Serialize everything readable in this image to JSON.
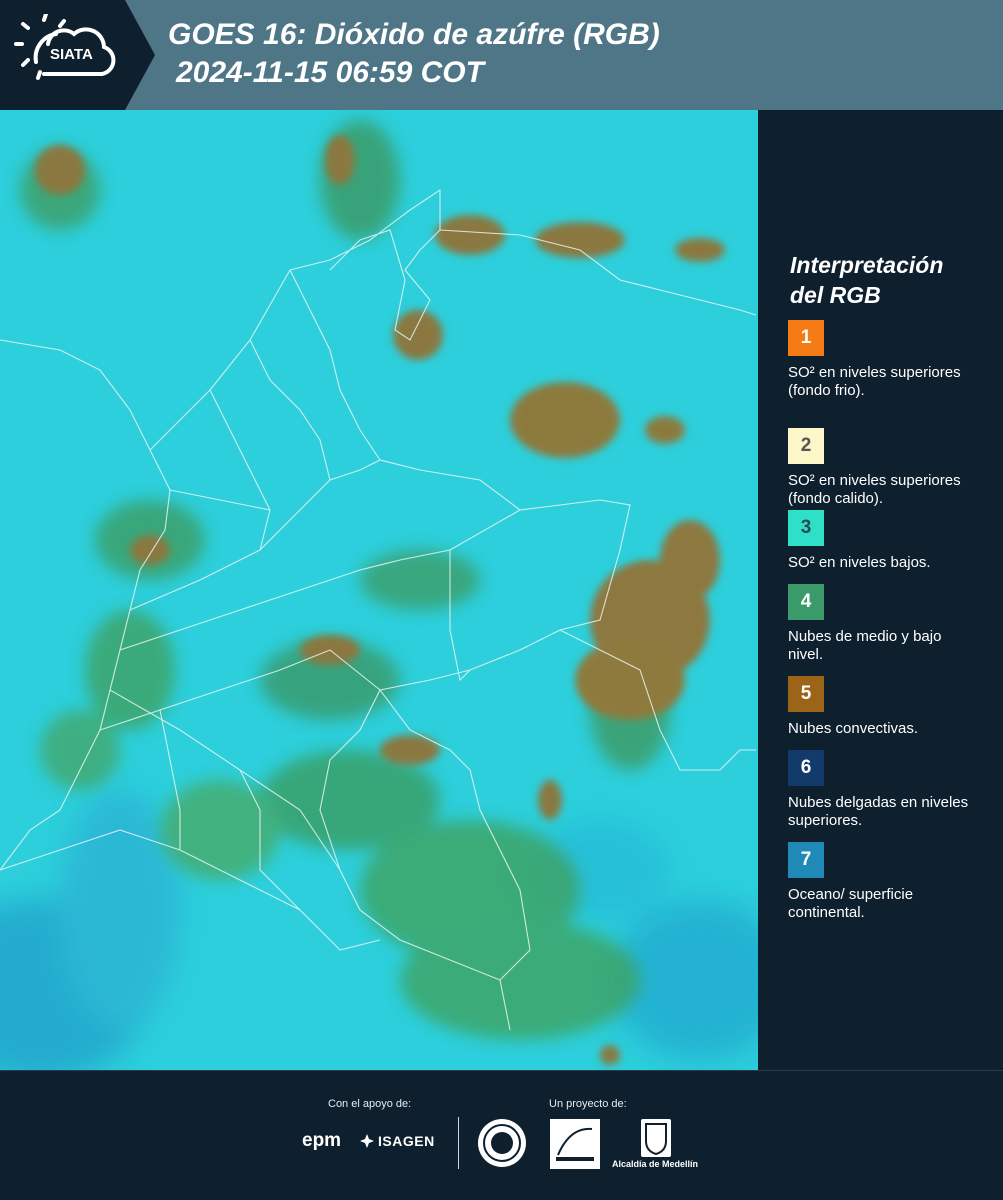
{
  "header": {
    "logo_text": "SIATA",
    "title_line1": "GOES 16: Dióxido de azúfre (RGB)",
    "title_line2": "2024-11-15 06:59 COT"
  },
  "legend": {
    "title_line1": "Interpretación",
    "title_line2": "del RGB",
    "items": [
      {
        "num": "1",
        "color": "#f47b16",
        "num_color": "#ffffff",
        "text": "SO² en niveles superiores (fondo frio)."
      },
      {
        "num": "2",
        "color": "#fdf6c8",
        "num_color": "#555555",
        "text": "SO² en niveles superiores (fondo calido)."
      },
      {
        "num": "3",
        "color": "#2fe0c8",
        "num_color": "#2b4a55",
        "text": "SO² en niveles bajos."
      },
      {
        "num": "4",
        "color": "#3a9a6a",
        "num_color": "#ffffff",
        "text": "Nubes de medio y bajo nivel."
      },
      {
        "num": "5",
        "color": "#9c6418",
        "num_color": "#ffffff",
        "text": "Nubes convectivas."
      },
      {
        "num": "6",
        "color": "#123a6a",
        "num_color": "#ffffff",
        "text": "Nubes delgadas en niveles superiores."
      },
      {
        "num": "7",
        "color": "#1f8ab8",
        "num_color": "#ffffff",
        "text": "Oceano/ superficie continental."
      }
    ]
  },
  "footer": {
    "support_label": "Con el apoyo de:",
    "project_label": "Un proyecto de:",
    "epm": "epm",
    "isagen": "ISAGEN",
    "alcaldia": "Alcaldía de Medellín"
  }
}
